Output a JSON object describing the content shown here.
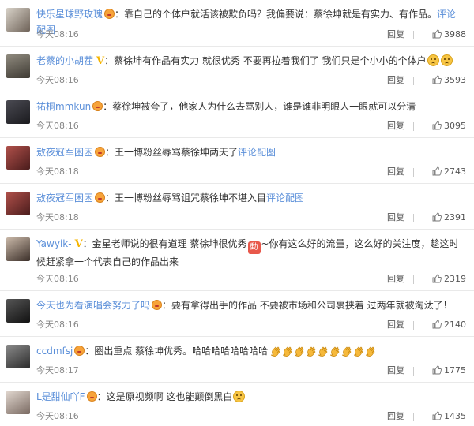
{
  "comments": [
    {
      "name": "快乐星球野玫瑰",
      "badge": true,
      "vip": false,
      "text": "靠自己的个体户就活该被欺负吗？我偏要说：蔡徐坤就是有实力、有作品。",
      "link": "评论配图",
      "emojis": [],
      "time": "今天08:16",
      "reply": "回复",
      "likes": "3988"
    },
    {
      "name": "老蔡的小胡茬",
      "badge": false,
      "vip": true,
      "text": "蔡徐坤有作品有实力 就很优秀 不要再拉着我们了 我们只是个小小的个体户",
      "link": "",
      "emojis": [
        "face",
        "face"
      ],
      "time": "今天08:16",
      "reply": "回复",
      "likes": "3593"
    },
    {
      "name": "祐桐mmkun",
      "badge": true,
      "vip": false,
      "text": "蔡徐坤被夸了，他家人为什么去骂别人，谁是谁非明眼人一眼就可以分清",
      "link": "",
      "emojis": [],
      "time": "今天08:16",
      "reply": "回复",
      "likes": "3095"
    },
    {
      "name": "敖夜冠军困困",
      "badge": true,
      "vip": false,
      "text": "王一博粉丝辱骂蔡徐坤两天了",
      "link": "评论配图",
      "emojis": [],
      "time": "今天08:18",
      "reply": "回复",
      "likes": "2743"
    },
    {
      "name": "敖夜冠军困困",
      "badge": true,
      "vip": false,
      "text": "王一博粉丝辱骂诅咒蔡徐坤不堪入目",
      "link": "评论配图",
      "emojis": [],
      "time": "今天08:18",
      "reply": "回复",
      "likes": "2391"
    },
    {
      "name": "Yawyik-",
      "badge": false,
      "vip": true,
      "text": "金星老师说的很有道理 蔡徐坤很优秀",
      "text2": "~你有这么好的流量，这么好的关注度，趁这时候赶紧拿一个代表自己的作品出来",
      "link": "",
      "emojis": [],
      "time": "今天08:16",
      "reply": "回复",
      "likes": "2319"
    },
    {
      "name": "今天也为看演唱会努力了吗",
      "badge": true,
      "vip": false,
      "text": "要有拿得出手的作品 不要被市场和公司裹挟着 过两年就被淘汰了！",
      "link": "",
      "emojis": [],
      "time": "今天08:16",
      "reply": "回复",
      "likes": "2140"
    },
    {
      "name": "ccdmfsj",
      "badge": true,
      "vip": false,
      "text": "圈出重点 蔡徐坤优秀。哈哈哈哈哈哈哈哈",
      "link": "",
      "emojis": [
        "clap",
        "clap",
        "clap",
        "clap",
        "clap",
        "clap",
        "clap",
        "clap",
        "clap"
      ],
      "time": "今天08:17",
      "reply": "回复",
      "likes": "1775"
    },
    {
      "name": "L是甜仙吖F",
      "badge": true,
      "vip": false,
      "text": "这是原视频啊 这也能颠倒黑白",
      "link": "",
      "emojis": [
        "face"
      ],
      "time": "今天08:16",
      "reply": "回复",
      "likes": "1435"
    }
  ]
}
